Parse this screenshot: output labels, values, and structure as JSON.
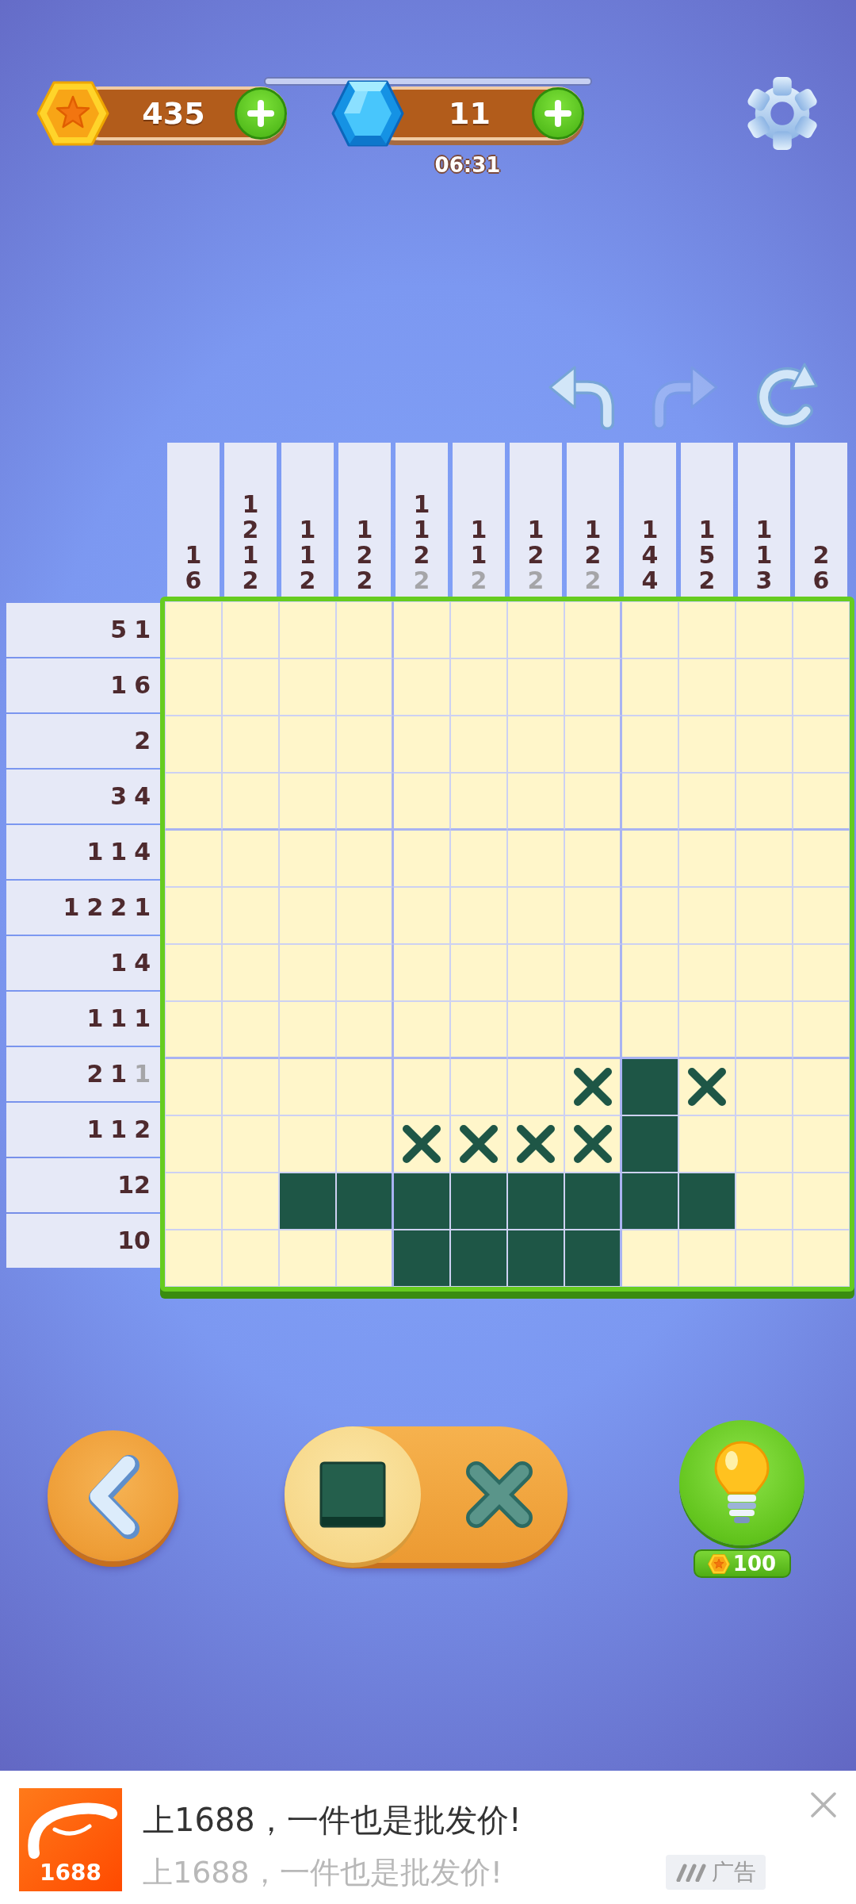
{
  "hud": {
    "coins": {
      "value": "435"
    },
    "gems": {
      "value": "11"
    },
    "timer_bar": {
      "level": 1
    },
    "timer": "06:31"
  },
  "tools": [
    {
      "kind": "undo",
      "disabled": false
    },
    {
      "kind": "redo",
      "disabled": true
    },
    {
      "kind": "restart",
      "disabled": false
    }
  ],
  "column_clues": [
    {
      "numbers": [
        {
          "text": "1",
          "done": false
        },
        {
          "text": "6",
          "done": false
        }
      ]
    },
    {
      "numbers": [
        {
          "text": "1",
          "done": false
        },
        {
          "text": "2",
          "done": false
        },
        {
          "text": "1",
          "done": false
        },
        {
          "text": "2",
          "done": false
        }
      ]
    },
    {
      "numbers": [
        {
          "text": "1",
          "done": false
        },
        {
          "text": "1",
          "done": false
        },
        {
          "text": "2",
          "done": false
        }
      ]
    },
    {
      "numbers": [
        {
          "text": "1",
          "done": false
        },
        {
          "text": "2",
          "done": false
        },
        {
          "text": "2",
          "done": false
        }
      ]
    },
    {
      "numbers": [
        {
          "text": "1",
          "done": false
        },
        {
          "text": "1",
          "done": false
        },
        {
          "text": "2",
          "done": false
        },
        {
          "text": "2",
          "done": true
        }
      ]
    },
    {
      "numbers": [
        {
          "text": "1",
          "done": false
        },
        {
          "text": "1",
          "done": false
        },
        {
          "text": "2",
          "done": true
        }
      ]
    },
    {
      "numbers": [
        {
          "text": "1",
          "done": false
        },
        {
          "text": "2",
          "done": false
        },
        {
          "text": "2",
          "done": true
        }
      ]
    },
    {
      "numbers": [
        {
          "text": "1",
          "done": false
        },
        {
          "text": "2",
          "done": false
        },
        {
          "text": "2",
          "done": true
        }
      ]
    },
    {
      "numbers": [
        {
          "text": "1",
          "done": false
        },
        {
          "text": "4",
          "done": false
        },
        {
          "text": "4",
          "done": false
        }
      ]
    },
    {
      "numbers": [
        {
          "text": "1",
          "done": false
        },
        {
          "text": "5",
          "done": false
        },
        {
          "text": "2",
          "done": false
        }
      ]
    },
    {
      "numbers": [
        {
          "text": "1",
          "done": false
        },
        {
          "text": "1",
          "done": false
        },
        {
          "text": "3",
          "done": false
        }
      ]
    },
    {
      "numbers": [
        {
          "text": "2",
          "done": false
        },
        {
          "text": "6",
          "done": false
        }
      ]
    }
  ],
  "row_clues": [
    {
      "numbers": [
        {
          "text": "5",
          "done": false
        },
        {
          "text": "1",
          "done": false
        }
      ]
    },
    {
      "numbers": [
        {
          "text": "1",
          "done": false
        },
        {
          "text": "6",
          "done": false
        }
      ]
    },
    {
      "numbers": [
        {
          "text": "2",
          "done": false
        }
      ]
    },
    {
      "numbers": [
        {
          "text": "3",
          "done": false
        },
        {
          "text": "4",
          "done": false
        }
      ]
    },
    {
      "numbers": [
        {
          "text": "1",
          "done": false
        },
        {
          "text": "1",
          "done": false
        },
        {
          "text": "4",
          "done": false
        }
      ]
    },
    {
      "numbers": [
        {
          "text": "1",
          "done": false
        },
        {
          "text": "2",
          "done": false
        },
        {
          "text": "2",
          "done": false
        },
        {
          "text": "1",
          "done": false
        }
      ]
    },
    {
      "numbers": [
        {
          "text": "1",
          "done": false
        },
        {
          "text": "4",
          "done": false
        }
      ]
    },
    {
      "numbers": [
        {
          "text": "1",
          "done": false
        },
        {
          "text": "1",
          "done": false
        },
        {
          "text": "1",
          "done": false
        }
      ]
    },
    {
      "numbers": [
        {
          "text": "2",
          "done": false
        },
        {
          "text": "1",
          "done": false
        },
        {
          "text": "1",
          "done": true
        }
      ]
    },
    {
      "numbers": [
        {
          "text": "1",
          "done": false
        },
        {
          "text": "1",
          "done": false
        },
        {
          "text": "2",
          "done": false
        }
      ]
    },
    {
      "numbers": [
        {
          "text": "12",
          "done": false
        }
      ]
    },
    {
      "numbers": [
        {
          "text": "10",
          "done": false
        }
      ]
    }
  ],
  "grid": {
    "rows": [
      [
        {
          "kind": "empty"
        },
        {
          "kind": "empty"
        },
        {
          "kind": "empty"
        },
        {
          "kind": "empty"
        },
        {
          "kind": "empty"
        },
        {
          "kind": "empty"
        },
        {
          "kind": "empty"
        },
        {
          "kind": "empty"
        },
        {
          "kind": "empty"
        },
        {
          "kind": "empty"
        },
        {
          "kind": "empty"
        },
        {
          "kind": "empty"
        }
      ],
      [
        {
          "kind": "empty"
        },
        {
          "kind": "empty"
        },
        {
          "kind": "empty"
        },
        {
          "kind": "empty"
        },
        {
          "kind": "empty"
        },
        {
          "kind": "empty"
        },
        {
          "kind": "empty"
        },
        {
          "kind": "empty"
        },
        {
          "kind": "empty"
        },
        {
          "kind": "empty"
        },
        {
          "kind": "empty"
        },
        {
          "kind": "empty"
        }
      ],
      [
        {
          "kind": "empty"
        },
        {
          "kind": "empty"
        },
        {
          "kind": "empty"
        },
        {
          "kind": "empty"
        },
        {
          "kind": "empty"
        },
        {
          "kind": "empty"
        },
        {
          "kind": "empty"
        },
        {
          "kind": "empty"
        },
        {
          "kind": "empty"
        },
        {
          "kind": "empty"
        },
        {
          "kind": "empty"
        },
        {
          "kind": "empty"
        }
      ],
      [
        {
          "kind": "empty"
        },
        {
          "kind": "empty"
        },
        {
          "kind": "empty"
        },
        {
          "kind": "empty"
        },
        {
          "kind": "empty"
        },
        {
          "kind": "empty"
        },
        {
          "kind": "empty"
        },
        {
          "kind": "empty"
        },
        {
          "kind": "empty"
        },
        {
          "kind": "empty"
        },
        {
          "kind": "empty"
        },
        {
          "kind": "empty"
        }
      ],
      [
        {
          "kind": "empty"
        },
        {
          "kind": "empty"
        },
        {
          "kind": "empty"
        },
        {
          "kind": "empty"
        },
        {
          "kind": "empty"
        },
        {
          "kind": "empty"
        },
        {
          "kind": "empty"
        },
        {
          "kind": "empty"
        },
        {
          "kind": "empty"
        },
        {
          "kind": "empty"
        },
        {
          "kind": "empty"
        },
        {
          "kind": "empty"
        }
      ],
      [
        {
          "kind": "empty"
        },
        {
          "kind": "empty"
        },
        {
          "kind": "empty"
        },
        {
          "kind": "empty"
        },
        {
          "kind": "empty"
        },
        {
          "kind": "empty"
        },
        {
          "kind": "empty"
        },
        {
          "kind": "empty"
        },
        {
          "kind": "empty"
        },
        {
          "kind": "empty"
        },
        {
          "kind": "empty"
        },
        {
          "kind": "empty"
        }
      ],
      [
        {
          "kind": "empty"
        },
        {
          "kind": "empty"
        },
        {
          "kind": "empty"
        },
        {
          "kind": "empty"
        },
        {
          "kind": "empty"
        },
        {
          "kind": "empty"
        },
        {
          "kind": "empty"
        },
        {
          "kind": "empty"
        },
        {
          "kind": "empty"
        },
        {
          "kind": "empty"
        },
        {
          "kind": "empty"
        },
        {
          "kind": "empty"
        }
      ],
      [
        {
          "kind": "empty"
        },
        {
          "kind": "empty"
        },
        {
          "kind": "empty"
        },
        {
          "kind": "empty"
        },
        {
          "kind": "empty"
        },
        {
          "kind": "empty"
        },
        {
          "kind": "empty"
        },
        {
          "kind": "empty"
        },
        {
          "kind": "empty"
        },
        {
          "kind": "empty"
        },
        {
          "kind": "empty"
        },
        {
          "kind": "empty"
        }
      ],
      [
        {
          "kind": "empty"
        },
        {
          "kind": "empty"
        },
        {
          "kind": "empty"
        },
        {
          "kind": "empty"
        },
        {
          "kind": "empty"
        },
        {
          "kind": "empty"
        },
        {
          "kind": "empty"
        },
        {
          "kind": "cross"
        },
        {
          "kind": "filled"
        },
        {
          "kind": "cross"
        },
        {
          "kind": "empty"
        },
        {
          "kind": "empty"
        }
      ],
      [
        {
          "kind": "empty"
        },
        {
          "kind": "empty"
        },
        {
          "kind": "empty"
        },
        {
          "kind": "empty"
        },
        {
          "kind": "cross"
        },
        {
          "kind": "cross"
        },
        {
          "kind": "cross"
        },
        {
          "kind": "cross"
        },
        {
          "kind": "filled"
        },
        {
          "kind": "empty"
        },
        {
          "kind": "empty"
        },
        {
          "kind": "empty"
        }
      ],
      [
        {
          "kind": "empty"
        },
        {
          "kind": "empty"
        },
        {
          "kind": "filled"
        },
        {
          "kind": "filled"
        },
        {
          "kind": "filled"
        },
        {
          "kind": "filled"
        },
        {
          "kind": "filled"
        },
        {
          "kind": "filled"
        },
        {
          "kind": "filled"
        },
        {
          "kind": "filled"
        },
        {
          "kind": "empty"
        },
        {
          "kind": "empty"
        }
      ],
      [
        {
          "kind": "empty"
        },
        {
          "kind": "empty"
        },
        {
          "kind": "empty"
        },
        {
          "kind": "empty"
        },
        {
          "kind": "filled"
        },
        {
          "kind": "filled"
        },
        {
          "kind": "filled"
        },
        {
          "kind": "filled"
        },
        {
          "kind": "empty"
        },
        {
          "kind": "empty"
        },
        {
          "kind": "empty"
        },
        {
          "kind": "empty"
        }
      ]
    ]
  },
  "controls": {
    "modes": [
      {
        "kind": "fill",
        "selected": true
      },
      {
        "kind": "cross",
        "selected": false
      }
    ],
    "hint": {
      "price": "100"
    }
  },
  "ad": {
    "logo_text": "1688",
    "title": "上1688，一件也是批发价!",
    "subtitle": "上1688，一件也是批发价!",
    "label": "广告"
  }
}
